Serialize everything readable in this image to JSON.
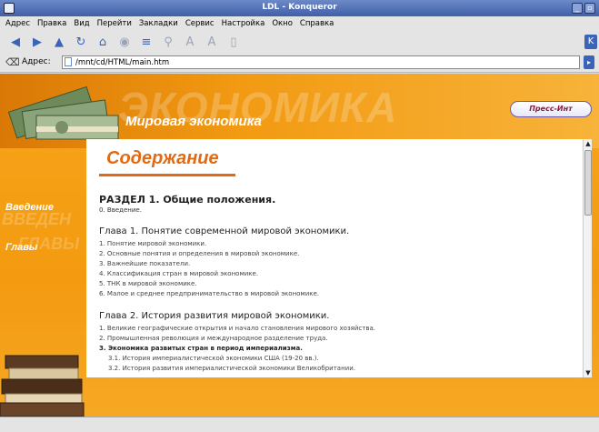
{
  "window": {
    "title": "LDL - Konqueror"
  },
  "menu": [
    "Адрес",
    "Правка",
    "Вид",
    "Перейти",
    "Закладки",
    "Сервис",
    "Настройка",
    "Окно",
    "Справка"
  ],
  "location": {
    "label": "Адрес:",
    "value": "/mnt/cd/HTML/main.htm"
  },
  "site": {
    "banner_big": "ЭКОНОМИКА",
    "banner_subtitle": "Мировая экономика",
    "logo": "Пресс-Инт",
    "nav_ghost_intro": "ВВЕДЕН",
    "nav_ghost_chapters": "ГЛАВЫ",
    "nav_intro": "Введение",
    "nav_chapters": "Главы"
  },
  "toc": {
    "title": "Содержание",
    "section": "РАЗДЕЛ 1. Общие положения.",
    "intro": "0. Введение.",
    "chapter1": {
      "title": "Глава 1. Понятие современной мировой экономики.",
      "items": [
        "1. Понятие мировой экономики.",
        "2. Основные понятия и определения в мировой экономике.",
        "3. Важнейшие показатели.",
        "4. Классификация стран в мировой экономике.",
        "5. ТНК в мировой экономике.",
        "6. Малое и среднее предпринимательство в мировой экономике."
      ]
    },
    "chapter2": {
      "title": "Глава 2. История развития мировой экономики.",
      "items": [
        "1. Великие географические открытия и начало становления мирового хозяйства.",
        "2. Промышленная революция и международное разделение труда.",
        "3. Экономика развитых стран в период империализма.",
        "3.1. История империалистической экономики США (19-20 вв.).",
        "3.2. История развития империалистической экономики Великобритании."
      ]
    }
  }
}
